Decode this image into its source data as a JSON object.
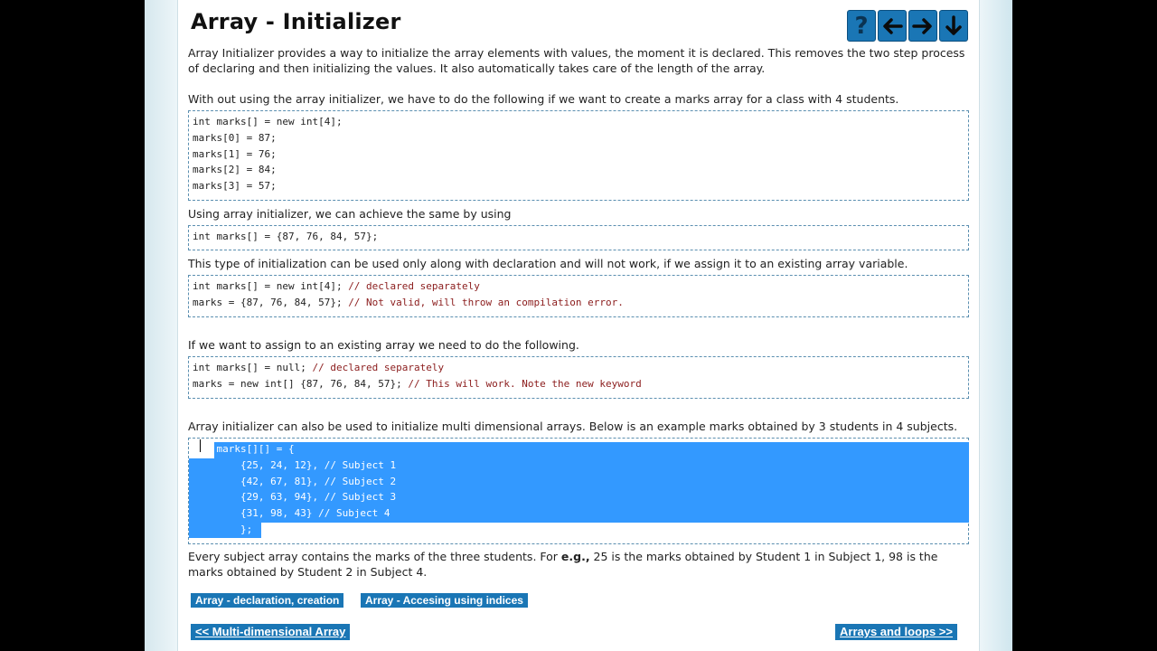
{
  "title": "Array - Initializer",
  "nav": {
    "help_icon": "question-mark-icon",
    "prev_icon": "arrow-left-icon",
    "next_icon": "arrow-right-icon",
    "down_icon": "arrow-down-icon"
  },
  "paragraphs": {
    "intro": "Array Initializer provides a way to initialize the array elements with values, the moment it is declared. This removes the two step process of declaring and then initializing the values. It also automatically takes care of the length of the array.",
    "without": "With out using the array initializer, we have to do the following if we want to create a marks array for a class with 4 students.",
    "using": "Using array initializer, we can achieve the same by using",
    "only_decl": "This type of initialization can be used only along with declaration and will not work, if we assign it to an existing array variable.",
    "existing": "If we want to assign to an existing array we need to do the following.",
    "multi": "Array initializer can also be used to initialize multi dimensional arrays. Below is an example marks obtained by 3 students in 4 subjects.",
    "every_a": "Every subject array contains the marks of the three students. For ",
    "every_eg": "e.g.,",
    "every_b": " 25 is the marks obtained by Student 1 in Subject 1, 98 is the marks obtained by Student 2 in Subject 4."
  },
  "code1": [
    "int marks[] = new int[4];",
    "marks[0] = 87;",
    "marks[1] = 76;",
    "marks[2] = 84;",
    "marks[3] = 57;"
  ],
  "code2": [
    "int marks[] = {87, 76, 84, 57};"
  ],
  "code3": [
    {
      "code": "int marks[] = new int[4]; ",
      "comment": "// declared separately"
    },
    {
      "code": "marks = {87, 76, 84, 57}; ",
      "comment": "// Not valid, will throw an compilation error."
    }
  ],
  "code4": [
    {
      "code": "int marks[] = null; ",
      "comment": "// declared separately"
    },
    {
      "code": "marks = new int[] {87, 76, 84, 57}; ",
      "comment": "// This will work. Note the new keyword"
    }
  ],
  "code5": [
    {
      "code": "int marks[][] = {",
      "comment": ""
    },
    {
      "code": "        {25, 24, 12}, ",
      "comment": "// Subject 1"
    },
    {
      "code": "        {42, 67, 81}, ",
      "comment": "// Subject 2"
    },
    {
      "code": "        {29, 63, 94}, ",
      "comment": "// Subject 3"
    },
    {
      "code": "        {31, 98, 43} ",
      "comment": "// Subject 4"
    },
    {
      "code": "        };",
      "comment": ""
    }
  ],
  "links": {
    "decl": "Array - declaration, creation",
    "indices": "Array - Accesing using indices",
    "prev": "<< Multi-dimensional Array",
    "next": "Arrays and loops >>"
  }
}
